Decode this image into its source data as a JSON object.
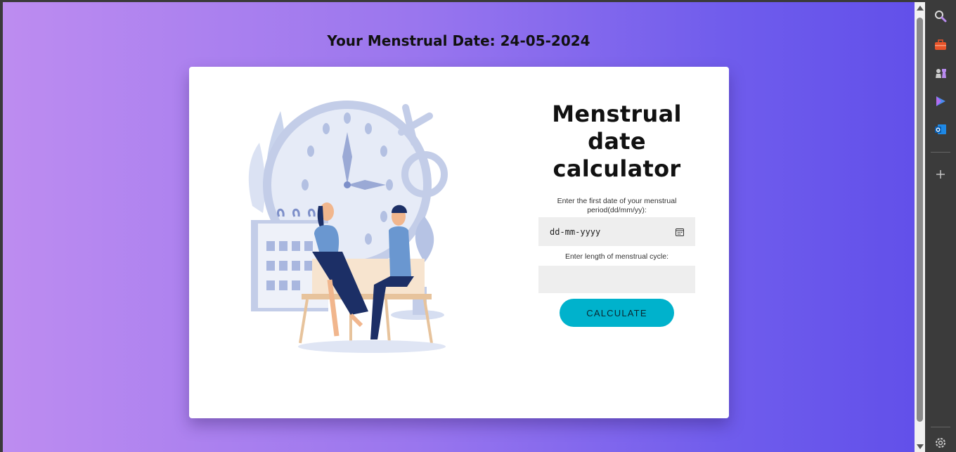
{
  "page": {
    "heading": "Your Menstrual Date: 24-05-2024"
  },
  "card": {
    "title": "Menstrual date calculator",
    "first_date_label": "Enter the first date of your menstrual period(dd/mm/yy):",
    "first_date_placeholder": "dd-mm-yyyy",
    "cycle_label": "Enter length of menstrual cycle:",
    "cycle_value": "",
    "calculate_label": "CALCULATE"
  },
  "sidebar": {
    "items": [
      "search-icon",
      "toolbox-icon",
      "chess-icon",
      "copilot-icon",
      "outlook-icon",
      "add-icon",
      "settings-icon"
    ]
  },
  "colors": {
    "gradient_start": "#bd8cf0",
    "gradient_end": "#6250ea",
    "button": "#00b2cc",
    "input_bg": "#eeeeee"
  }
}
